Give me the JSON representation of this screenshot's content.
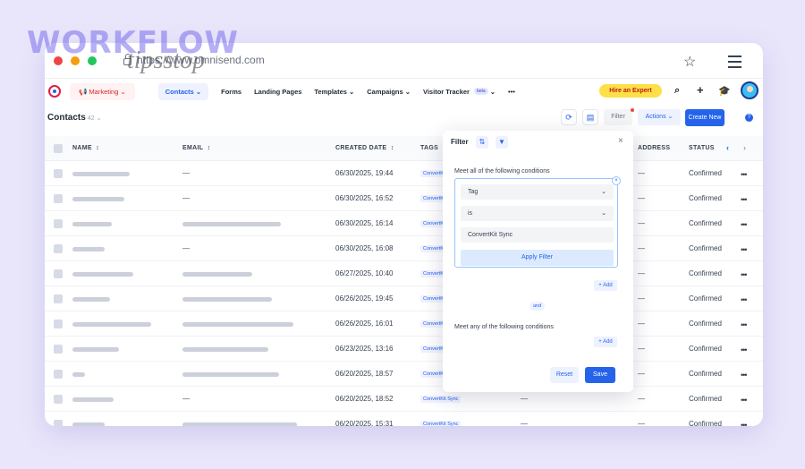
{
  "watermark": {
    "line1": "WORKFLOW",
    "line2": "tipsstop"
  },
  "browser": {
    "url": "https://www.omnisend.com"
  },
  "nav": {
    "marketing": "Marketing",
    "items": [
      {
        "label": "Contacts",
        "chevron": "⌄",
        "active": true
      },
      {
        "label": "Forms",
        "chevron": ""
      },
      {
        "label": "Landing Pages",
        "chevron": ""
      },
      {
        "label": "Templates",
        "chevron": "⌄"
      },
      {
        "label": "Campaigns",
        "chevron": "⌄"
      },
      {
        "label": "Visitor Tracker",
        "chevron": "⌄",
        "badge": "beta"
      }
    ],
    "more": "•••",
    "hire": "Hire an Expert"
  },
  "toolbar": {
    "title": "Contacts",
    "count": "42",
    "filter": "Filter",
    "actions": "Actions",
    "create": "Create New",
    "help": "?"
  },
  "table": {
    "headers": {
      "name": "NAME",
      "email": "EMAIL",
      "created": "CREATED DATE",
      "tags": "TAGS",
      "address": "ADDRESS",
      "status": "STATUS"
    },
    "rows": [
      {
        "email": "—",
        "date": "06/30/2025, 19:44",
        "tag": "ConvertKit Sync",
        "phone": "",
        "address": "—",
        "status": "Confirmed",
        "nw": 64,
        "ew": 0
      },
      {
        "email": "—",
        "date": "06/30/2025, 16:52",
        "tag": "ConvertKit Sync",
        "phone": "",
        "address": "—",
        "status": "Confirmed",
        "nw": 58,
        "ew": 0
      },
      {
        "email": "",
        "date": "06/30/2025, 16:14",
        "tag": "ConvertKit Sync",
        "phone": "",
        "address": "—",
        "status": "Confirmed",
        "nw": 44,
        "ew": 110
      },
      {
        "email": "—",
        "date": "06/30/2025, 16:08",
        "tag": "ConvertKit Sync",
        "phone": "",
        "address": "—",
        "status": "Confirmed",
        "nw": 36,
        "ew": 0
      },
      {
        "email": "",
        "date": "06/27/2025, 10:40",
        "tag": "ConvertKit Sync",
        "phone": "",
        "address": "—",
        "status": "Confirmed",
        "nw": 68,
        "ew": 78
      },
      {
        "email": "",
        "date": "06/26/2025, 19:45",
        "tag": "ConvertKit Sync",
        "phone": "",
        "address": "—",
        "status": "Confirmed",
        "nw": 42,
        "ew": 100
      },
      {
        "email": "",
        "date": "06/26/2025, 16:01",
        "tag": "ConvertKit Sync",
        "phone": "",
        "address": "—",
        "status": "Confirmed",
        "nw": 88,
        "ew": 124
      },
      {
        "email": "",
        "date": "06/23/2025, 13:16",
        "tag": "ConvertKit Sync",
        "phone": "",
        "address": "—",
        "status": "Confirmed",
        "nw": 52,
        "ew": 96
      },
      {
        "email": "",
        "date": "06/20/2025, 18:57",
        "tag": "ConvertKit Sync",
        "phone": "",
        "address": "—",
        "status": "Confirmed",
        "nw": 14,
        "ew": 108
      },
      {
        "email": "—",
        "date": "06/20/2025, 18:52",
        "tag": "ConvertKit Sync",
        "phone": "—",
        "address": "—",
        "status": "Confirmed",
        "nw": 46,
        "ew": 0
      },
      {
        "email": "",
        "date": "06/20/2025, 15:31",
        "tag": "ConvertKit Sync",
        "phone": "—",
        "address": "—",
        "status": "Confirmed",
        "nw": 36,
        "ew": 128
      }
    ]
  },
  "filter": {
    "title": "Filter",
    "close": "×",
    "all_label": "Meet all of the following conditions",
    "field": "Tag",
    "operator": "is",
    "value": "ConvertKit Sync",
    "apply": "Apply Filter",
    "add": "+ Add",
    "and": "and",
    "any_label": "Meet any of the following conditions",
    "reset": "Reset",
    "save": "Save"
  },
  "colors": {
    "accent": "#2563eb",
    "hire": "#fde047",
    "background": "#e9e6fb"
  }
}
